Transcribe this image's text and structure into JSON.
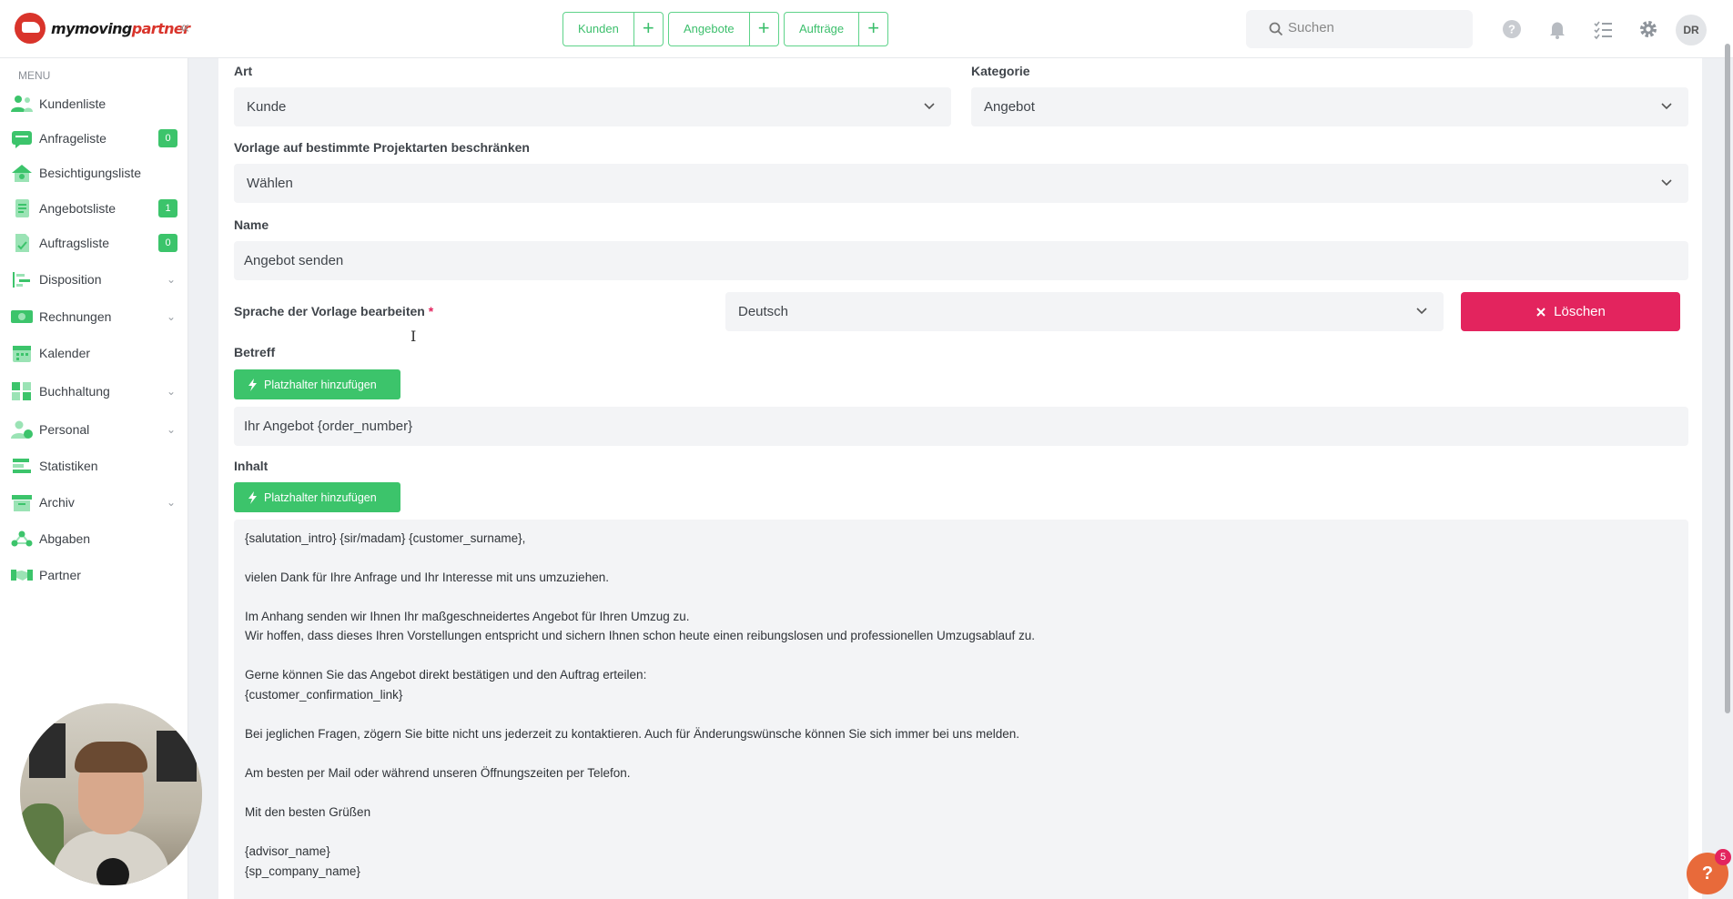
{
  "brand": {
    "name_part1": "my",
    "name_part2": "moving",
    "name_part3": "partner"
  },
  "header": {
    "quick_actions": [
      {
        "label": "Kunden",
        "plus": "+"
      },
      {
        "label": "Angebote",
        "plus": "+"
      },
      {
        "label": "Aufträge",
        "plus": "+"
      }
    ],
    "search": {
      "placeholder": "Suchen"
    },
    "avatar_initials": "DR",
    "icons": [
      "help-icon",
      "bell-icon",
      "checklist-icon",
      "gear-icon"
    ]
  },
  "sidebar": {
    "menu_heading": "MENU",
    "items": [
      {
        "label": "Kundenliste",
        "icon": "customers-icon"
      },
      {
        "label": "Anfrageliste",
        "icon": "inquiry-icon",
        "badge": "0"
      },
      {
        "label": "Besichtigungsliste",
        "icon": "inspection-icon"
      },
      {
        "label": "Angebotsliste",
        "icon": "offer-icon",
        "badge": "1"
      },
      {
        "label": "Auftragsliste",
        "icon": "order-icon",
        "badge": "0"
      },
      {
        "label": "Disposition",
        "icon": "disposition-icon",
        "expandable": true
      },
      {
        "label": "Rechnungen",
        "icon": "invoice-icon",
        "expandable": true
      },
      {
        "label": "Kalender",
        "icon": "calendar-icon"
      },
      {
        "label": "Buchhaltung",
        "icon": "accounting-icon",
        "expandable": true
      },
      {
        "label": "Personal",
        "icon": "staff-icon",
        "expandable": true
      },
      {
        "label": "Statistiken",
        "icon": "statistics-icon"
      },
      {
        "label": "Archiv",
        "icon": "archive-icon",
        "expandable": true
      },
      {
        "label": "Abgaben",
        "icon": "network-icon"
      },
      {
        "label": "Partner",
        "icon": "handshake-icon"
      }
    ],
    "accent_color": "#3cc46b"
  },
  "form": {
    "art": {
      "label": "Art",
      "value": "Kunde"
    },
    "kategorie": {
      "label": "Kategorie",
      "value": "Angebot"
    },
    "projektarten": {
      "label": "Vorlage auf bestimmte Projektarten beschränken",
      "value": "Wählen"
    },
    "name": {
      "label": "Name",
      "value": "Angebot senden"
    },
    "sprache": {
      "label": "Sprache der Vorlage bearbeiten",
      "required_mark": "*",
      "value": "Deutsch"
    },
    "delete_button": "Löschen",
    "betreff": {
      "label": "Betreff",
      "placeholder_button": "Platzhalter hinzufügen",
      "value": "Ihr Angebot {order_number}"
    },
    "inhalt": {
      "label": "Inhalt",
      "placeholder_button": "Platzhalter hinzufügen",
      "lines": [
        "{salutation_intro} {sir/madam} {customer_surname},",
        "vielen Dank für Ihre Anfrage und Ihr Interesse mit uns umzuziehen.",
        "Im Anhang senden wir Ihnen Ihr maßgeschneidertes Angebot für Ihren Umzug zu.",
        "Wir hoffen, dass dieses Ihren Vorstellungen entspricht und sichern Ihnen schon heute einen reibungslosen und professionellen Umzugsablauf zu.",
        "Gerne können Sie das Angebot direkt bestätigen und den Auftrag erteilen:",
        "{customer_confirmation_link}",
        "Bei jeglichen Fragen, zögern Sie bitte nicht uns jederzeit zu kontaktieren. Auch für Änderungswünsche können Sie sich immer bei uns melden.",
        "Am besten per Mail oder während unseren Öffnungszeiten per Telefon.",
        "Mit den besten Grüßen",
        "{advisor_name}",
        "{sp_company_name}"
      ]
    }
  },
  "help": {
    "label": "?",
    "badge": "5"
  },
  "colors": {
    "primary_green": "#3cc46b",
    "danger": "#e3245e",
    "field_bg": "#f3f4f6"
  }
}
